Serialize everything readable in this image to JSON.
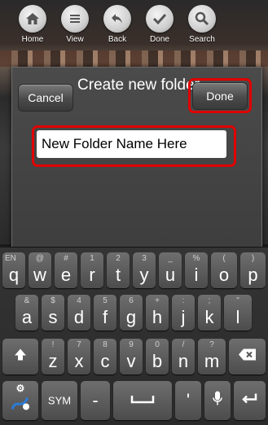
{
  "toolbar": [
    {
      "label": "Home",
      "icon": "home-icon"
    },
    {
      "label": "View",
      "icon": "list-icon"
    },
    {
      "label": "Back",
      "icon": "back-arrow-icon"
    },
    {
      "label": "Done",
      "icon": "checkmark-icon"
    },
    {
      "label": "Search",
      "icon": "search-icon"
    }
  ],
  "dialog": {
    "title": "Create new folder",
    "cancel_label": "Cancel",
    "done_label": "Done",
    "input_value": "New Folder Name Here"
  },
  "keyboard": {
    "row1": [
      {
        "key": "q",
        "alt": "EN"
      },
      {
        "key": "w",
        "alt": "@"
      },
      {
        "key": "e",
        "alt": "#"
      },
      {
        "key": "r",
        "alt": "1"
      },
      {
        "key": "t",
        "alt": "2"
      },
      {
        "key": "y",
        "alt": "3"
      },
      {
        "key": "u",
        "alt": "_"
      },
      {
        "key": "i",
        "alt": "%"
      },
      {
        "key": "o",
        "alt": "("
      },
      {
        "key": "p",
        "alt": ")"
      }
    ],
    "row2": [
      {
        "key": "a",
        "alt": "&"
      },
      {
        "key": "s",
        "alt": "$"
      },
      {
        "key": "d",
        "alt": "4"
      },
      {
        "key": "f",
        "alt": "5"
      },
      {
        "key": "g",
        "alt": "6"
      },
      {
        "key": "h",
        "alt": "+"
      },
      {
        "key": "j",
        "alt": ":"
      },
      {
        "key": "k",
        "alt": ";"
      },
      {
        "key": "l",
        "alt": "\""
      }
    ],
    "row3": [
      {
        "key": "z",
        "alt": "!"
      },
      {
        "key": "x",
        "alt": "7"
      },
      {
        "key": "c",
        "alt": "8"
      },
      {
        "key": "v",
        "alt": "9"
      },
      {
        "key": "b",
        "alt": "0"
      },
      {
        "key": "n",
        "alt": "/"
      },
      {
        "key": "m",
        "alt": "?"
      }
    ],
    "sym_label": "SYM",
    "dash_label": "-",
    "quote_label": "'",
    "settings_label": "⚙"
  }
}
